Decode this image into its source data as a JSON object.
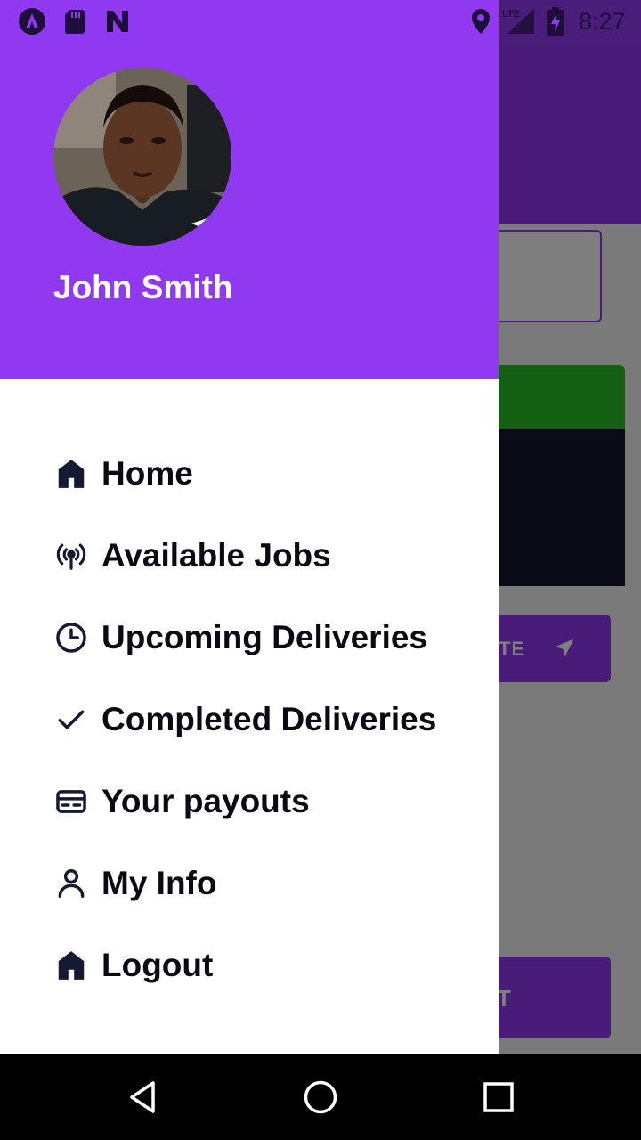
{
  "status_bar": {
    "time": "8:27",
    "network": "LTE",
    "left_icons": [
      "app-a-icon",
      "sd-card-icon",
      "n-logo-icon"
    ],
    "right_icons": [
      "location-pin-icon",
      "signal-lte-icon",
      "battery-charging-icon"
    ]
  },
  "background_app": {
    "button_partial_label": "TE",
    "bottom_button_partial_label": "T"
  },
  "drawer": {
    "user": {
      "name": "John Smith",
      "avatar": "profile-photo"
    },
    "menu": [
      {
        "label": "Home",
        "icon": "home-icon"
      },
      {
        "label": "Available Jobs",
        "icon": "broadcast-icon"
      },
      {
        "label": "Upcoming Deliveries",
        "icon": "clock-icon"
      },
      {
        "label": "Completed Deliveries",
        "icon": "check-icon"
      },
      {
        "label": "Your payouts",
        "icon": "credit-card-icon"
      },
      {
        "label": "My Info",
        "icon": "person-icon"
      },
      {
        "label": "Logout",
        "icon": "home-icon"
      }
    ]
  },
  "nav_bar": {
    "buttons": [
      "back-icon",
      "home-circle-icon",
      "recents-icon"
    ]
  },
  "colors": {
    "brand_purple": "#9139f1",
    "drawer_bg": "#ffffff",
    "text_dark": "#0a0a14",
    "green": "#2cc12a"
  }
}
